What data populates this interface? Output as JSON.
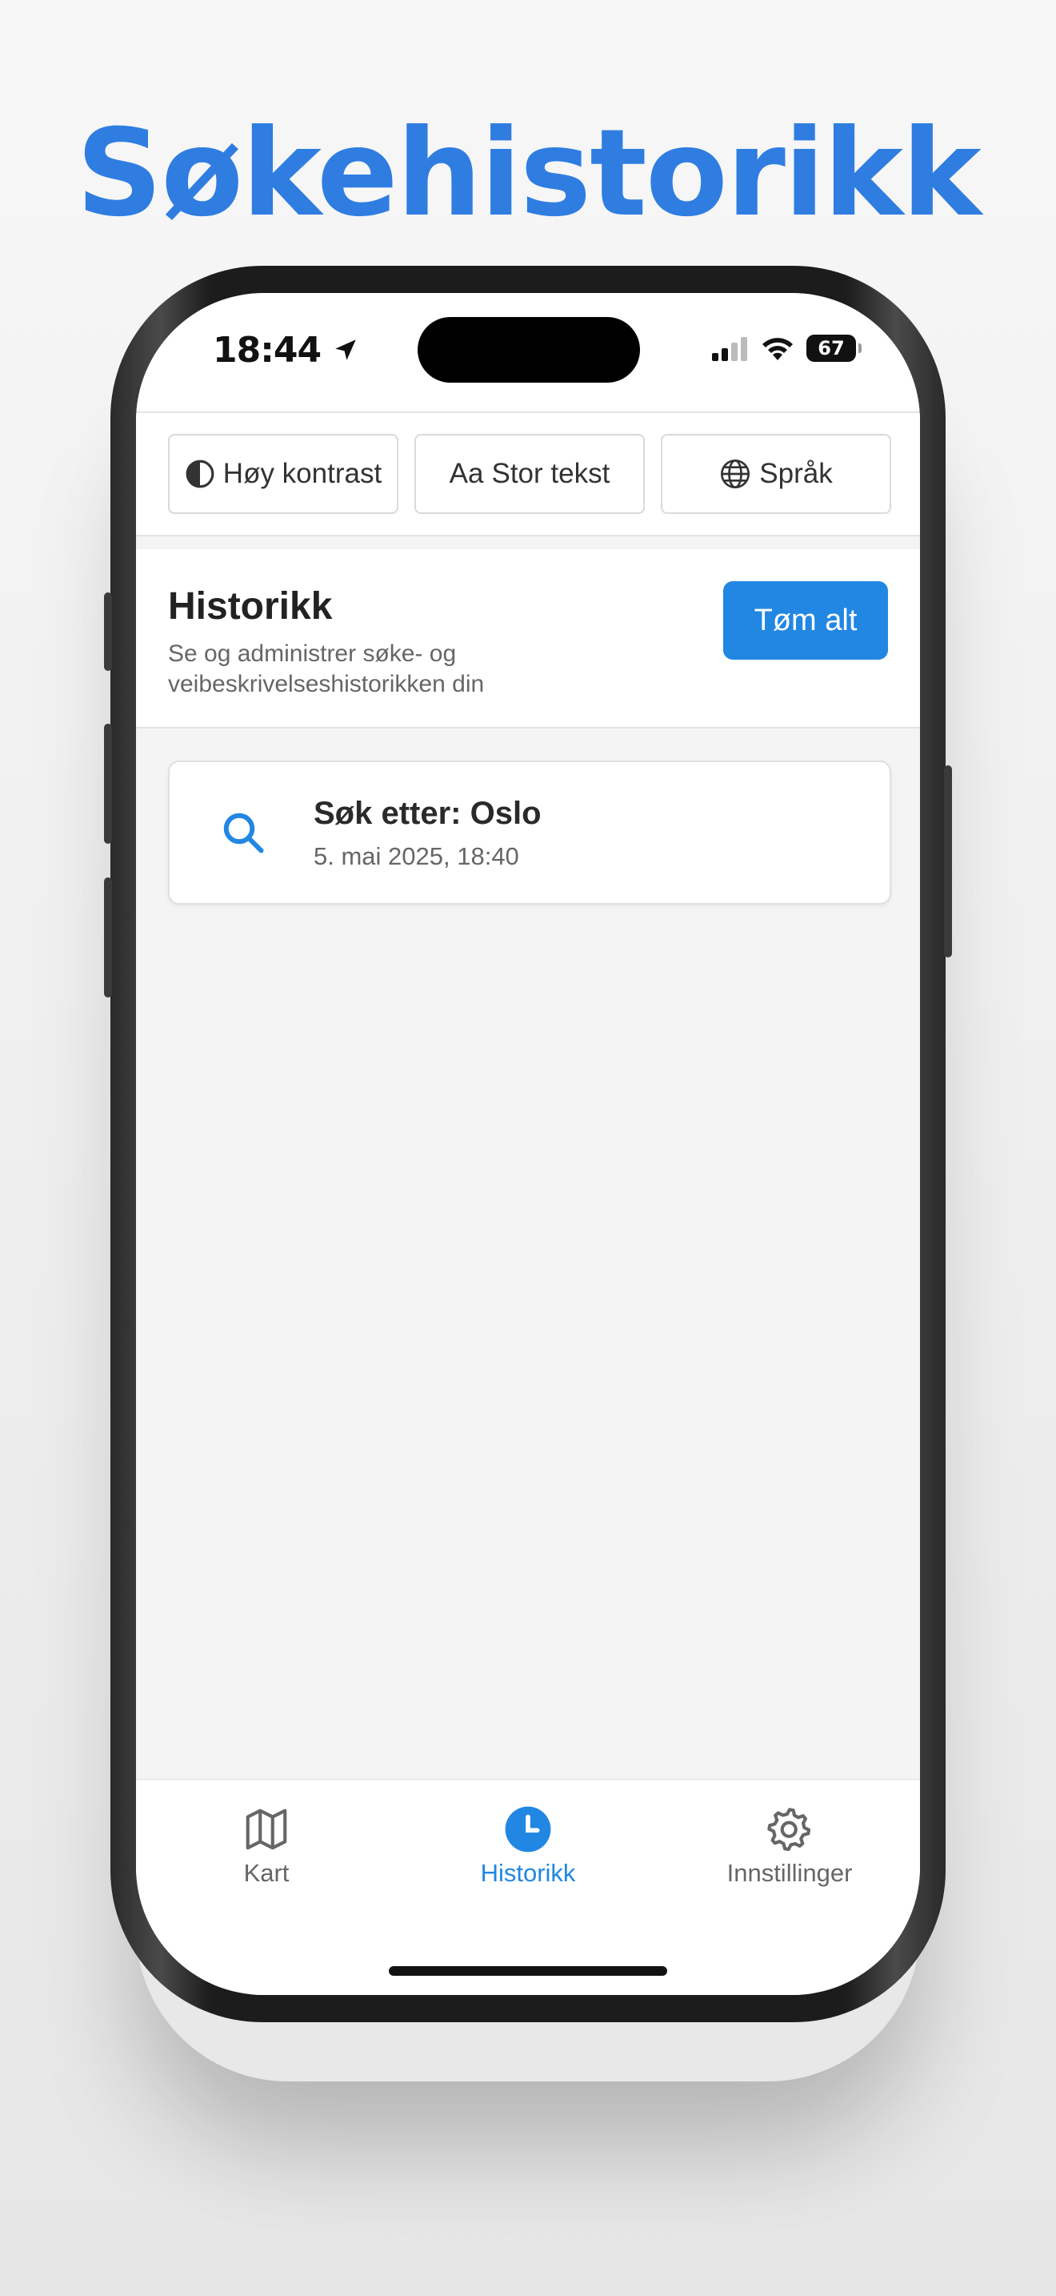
{
  "headline": "Søkehistorikk",
  "status_bar": {
    "time": "18:44",
    "battery": "67",
    "icons": [
      "location-arrow-icon",
      "cellular-signal-icon",
      "wifi-icon",
      "battery-icon"
    ]
  },
  "accessibility": {
    "high_contrast": {
      "label": "Høy kontrast",
      "icon": "contrast-icon"
    },
    "large_text": {
      "label": "Stor tekst",
      "icon": "text-size-icon",
      "icon_text": "Aa"
    },
    "language": {
      "label": "Språk",
      "icon": "globe-icon"
    }
  },
  "history": {
    "title": "Historikk",
    "subtitle": "Se og administrer søke- og veibeskrivelseshistorikken din",
    "clear_label": "Tøm alt",
    "items": [
      {
        "icon": "search-icon",
        "title": "Søk etter: Oslo",
        "date": "5. mai 2025, 18:40"
      }
    ]
  },
  "tabbar": {
    "tabs": [
      {
        "label": "Kart",
        "icon": "map-icon",
        "active": false
      },
      {
        "label": "Historikk",
        "icon": "clock-icon",
        "active": true
      },
      {
        "label": "Innstillinger",
        "icon": "gear-icon",
        "active": false
      }
    ]
  },
  "colors": {
    "accent": "#2187e3",
    "headline": "#2f7de1",
    "text": "#2a2a2a",
    "muted": "#666666"
  }
}
